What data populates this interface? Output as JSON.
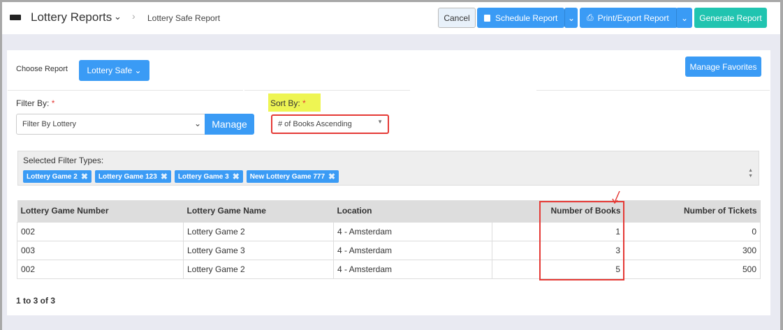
{
  "header": {
    "title": "Lottery Reports",
    "breadcrumb": "Lottery Safe Report",
    "cancel": "Cancel",
    "schedule": "Schedule Report",
    "print": "Print/Export Report",
    "generate": "Generate Report"
  },
  "report": {
    "choose_label": "Choose Report",
    "selected": "Lottery Safe",
    "manage_favorites": "Manage Favorites"
  },
  "filter": {
    "label": "Filter By:",
    "required": "*",
    "value": "Filter By Lottery",
    "manage": "Manage"
  },
  "sort": {
    "label": "Sort By:",
    "required": "*",
    "value": "# of Books Ascending"
  },
  "selected_filters": {
    "label": "Selected Filter Types:",
    "tags": [
      "Lottery Game 2",
      "Lottery Game 123",
      "Lottery Game 3",
      "New Lottery Game 777"
    ]
  },
  "table": {
    "headers": [
      "Lottery Game Number",
      "Lottery Game Name",
      "Location",
      "Number of Books",
      "Number of Tickets"
    ],
    "rows": [
      [
        "002",
        "Lottery Game 2",
        "4 - Amsterdam",
        "1",
        "0"
      ],
      [
        "003",
        "Lottery Game 3",
        "4 - Amsterdam",
        "3",
        "300"
      ],
      [
        "002",
        "Lottery Game 2",
        "4 - Amsterdam",
        "5",
        "500"
      ]
    ]
  },
  "pagination": "1 to 3 of 3"
}
